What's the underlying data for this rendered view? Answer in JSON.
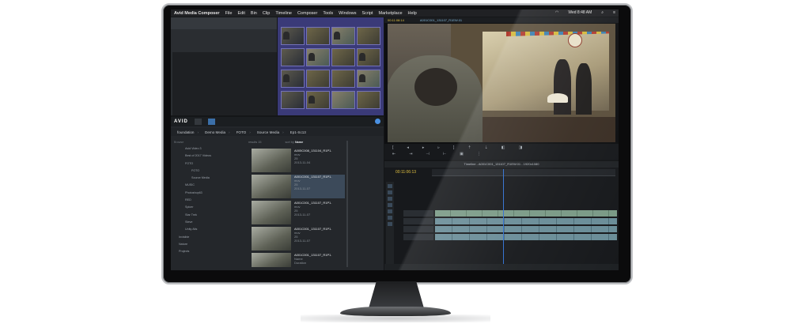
{
  "menubar": {
    "app": "Avid Media Composer",
    "items": [
      "File",
      "Edit",
      "Bin",
      "Clip",
      "Timeline",
      "Composer",
      "Tools",
      "Windows",
      "Script",
      "Marketplace",
      "Help"
    ],
    "clock": "Wed 8:48 AM"
  },
  "media_browser": {
    "logo": "AVID",
    "breadcrumb": [
      "foundation",
      "Demo Media",
      "FOTO",
      "Source Media",
      "Ep1-Sc13"
    ],
    "results_count": "results 15",
    "sort_by_label": "sort by",
    "sort_by_value": "Name",
    "tree": {
      "header": "Browse",
      "items": [
        "Avid Video 3",
        "Best of 2017 Videos",
        "FOTO",
        "FOTO",
        "Source Media",
        "MUSIC",
        "Photoshop63",
        "RED",
        "Spicer",
        "Star Trek",
        "Steve",
        "Unity Alts",
        "Invisible",
        "Nature",
        "Projects"
      ]
    },
    "results": [
      {
        "name": "A005C008_131104_R1P1.",
        "line2": "mov",
        "line3": "25",
        "line4": "2013-11-04"
      },
      {
        "name": "A001C001_131107_R1P1.",
        "line2": "mov",
        "line3": "25",
        "line4": "2013-11-07"
      },
      {
        "name": "A001C001_131107_R1P1.",
        "line2": "mov",
        "line3": "25",
        "line4": "2013-11-07"
      },
      {
        "name": "A001C001_131107_R1P1.",
        "line2": "mov",
        "line3": "25",
        "line4": "2013-11-07"
      },
      {
        "name": "A001C001_131107_R1P1.",
        "line2": "Name",
        "line3": "Duration",
        "line4": ""
      }
    ]
  },
  "timeline": {
    "title": "Timeline - A001C001_131107_R1EW.01 - 1920x1080",
    "timecode": "00:11:06:13"
  },
  "monitor": {
    "timecode": "00:11:08:14",
    "clip_name": "A001C001_131107_R1EW.01"
  }
}
